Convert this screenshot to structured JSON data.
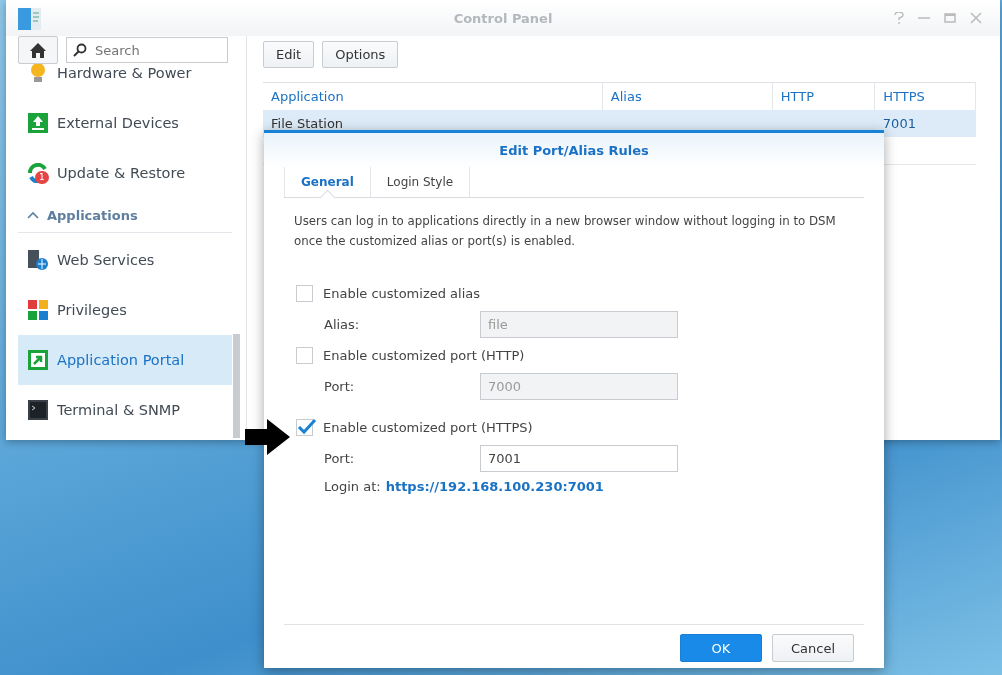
{
  "window": {
    "title": "Control Panel"
  },
  "sidebar": {
    "search": {
      "placeholder": "Search"
    },
    "items": [
      {
        "kind": "item",
        "label": "Hardware & Power",
        "selected": false
      },
      {
        "kind": "item",
        "label": "External Devices",
        "selected": false
      },
      {
        "kind": "item",
        "label": "Update & Restore",
        "selected": false,
        "badge": "1"
      },
      {
        "kind": "section",
        "label": "Applications",
        "expanded": true
      },
      {
        "kind": "item",
        "label": "Web Services",
        "selected": false
      },
      {
        "kind": "item",
        "label": "Privileges",
        "selected": false
      },
      {
        "kind": "item",
        "label": "Application Portal",
        "selected": true
      },
      {
        "kind": "item",
        "label": "Terminal & SNMP",
        "selected": false
      }
    ]
  },
  "toolbar": {
    "buttons": [
      "Edit",
      "Options"
    ]
  },
  "table": {
    "columns": [
      "Application",
      "Alias",
      "HTTP",
      "HTTPS"
    ],
    "rows": [
      {
        "application": "File Station",
        "https": "7001",
        "selected": true
      }
    ]
  },
  "dialog": {
    "title": "Edit Port/Alias Rules",
    "tabs": [
      {
        "label": "General",
        "selected": true
      },
      {
        "label": "Login Style",
        "selected": false
      }
    ],
    "description": "Users can log in to applications directly in a new browser window without logging in to DSM once the customized alias or port(s) is enabled.",
    "options": [
      {
        "kind": "checkbox",
        "label": "Enable customized alias",
        "checked": false
      },
      {
        "kind": "field",
        "label": "Alias:",
        "value": "file",
        "disabled": true
      },
      {
        "kind": "checkbox",
        "label": "Enable customized port (HTTP)",
        "checked": false
      },
      {
        "kind": "field",
        "label": "Port:",
        "value": "7000",
        "disabled": true
      },
      {
        "kind": "checkbox",
        "label": "Enable customized port (HTTPS)",
        "checked": true
      },
      {
        "kind": "field",
        "label": "Port:",
        "value": "7001",
        "disabled": false
      }
    ],
    "login": {
      "label": "Login at:",
      "link": "https://192.168.100.230:7001"
    },
    "buttons": [
      {
        "label": "OK",
        "kind": "primary"
      },
      {
        "label": "Cancel",
        "kind": "secondary"
      }
    ]
  }
}
